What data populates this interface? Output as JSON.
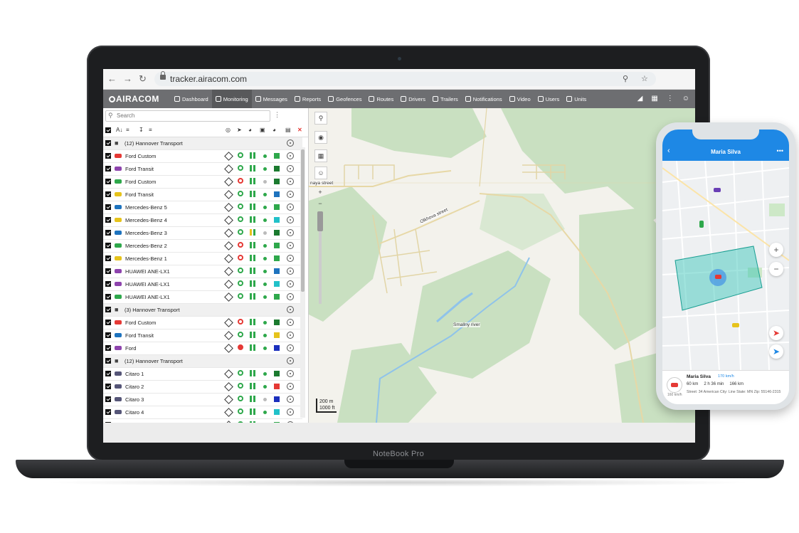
{
  "browser": {
    "url": "tracker.airacom.com",
    "back_icon": "arrow-left-icon",
    "forward_icon": "arrow-right-icon",
    "reload_icon": "reload-icon"
  },
  "app": {
    "brand": "AIRACOM",
    "nav": [
      {
        "label": "Dashboard",
        "icon": "chart-icon"
      },
      {
        "label": "Monitoring",
        "icon": "globe-icon"
      },
      {
        "label": "Messages",
        "icon": "document-icon"
      },
      {
        "label": "Reports",
        "icon": "report-icon"
      },
      {
        "label": "Geofences",
        "icon": "geofence-icon"
      },
      {
        "label": "Routes",
        "icon": "route-icon"
      },
      {
        "label": "Drivers",
        "icon": "steering-icon"
      },
      {
        "label": "Trailers",
        "icon": "trailer-icon"
      },
      {
        "label": "Notifications",
        "icon": "clock-icon"
      },
      {
        "label": "Video",
        "icon": "video-icon"
      },
      {
        "label": "Users",
        "icon": "user-icon"
      },
      {
        "label": "Units",
        "icon": "bus-icon"
      }
    ],
    "active_nav": "Monitoring"
  },
  "sidebar": {
    "search_placeholder": "Search",
    "rows": [
      {
        "type": "group",
        "label": "(12) Hannover Transport"
      },
      {
        "type": "unit",
        "label": "Ford Custom",
        "car": "#e53935",
        "ign": "green",
        "pause": "green",
        "dot": "green",
        "color": "#2ea84b"
      },
      {
        "type": "unit",
        "label": "Ford Transit",
        "car": "#8e44ad",
        "ign": "green",
        "pause": "green",
        "dot": "green",
        "color": "#1b7a2f"
      },
      {
        "type": "unit",
        "label": "Ford Custom",
        "car": "#2ea84b",
        "ign": "red",
        "pause": "green",
        "dot": "grey",
        "color": "#1b7a2f"
      },
      {
        "type": "unit",
        "label": "Ford Transit",
        "car": "#e6c31c",
        "ign": "green",
        "pause": "green",
        "dot": "green",
        "color": "#1e73be"
      },
      {
        "type": "unit",
        "label": "Mercedes-Benz 5",
        "car": "#1e73be",
        "ign": "green",
        "pause": "green",
        "dot": "green",
        "color": "#2ea84b"
      },
      {
        "type": "unit",
        "label": "Mercedes-Benz 4",
        "car": "#e6c31c",
        "ign": "green",
        "pause": "green",
        "dot": "green",
        "color": "#21c1c9"
      },
      {
        "type": "unit",
        "label": "Mercedes-Benz 3",
        "car": "#1e73be",
        "ign": "green",
        "pause": "yellow",
        "dot": "grey",
        "color": "#1b7a2f"
      },
      {
        "type": "unit",
        "label": "Mercedes-Benz 2",
        "car": "#2ea84b",
        "ign": "red",
        "pause": "green",
        "dot": "green",
        "color": "#2ea84b"
      },
      {
        "type": "unit",
        "label": "Mercedes-Benz 1",
        "car": "#e6c31c",
        "ign": "red",
        "pause": "green",
        "dot": "green",
        "color": "#2ea84b"
      },
      {
        "type": "unit",
        "label": "HUAWEI ANE-LX1",
        "car": "#8e44ad",
        "ign": "green",
        "pause": "green",
        "dot": "green",
        "color": "#1e73be"
      },
      {
        "type": "unit",
        "label": "HUAWEI ANE-LX1",
        "car": "#8e44ad",
        "ign": "green",
        "pause": "green",
        "dot": "green",
        "color": "#21c1c9"
      },
      {
        "type": "unit",
        "label": "HUAWEI ANE-LX1",
        "car": "#2ea84b",
        "ign": "green",
        "pause": "green",
        "dot": "green",
        "color": "#2ea84b"
      },
      {
        "type": "group",
        "label": "(3) Hannover Transport"
      },
      {
        "type": "unit",
        "label": "Ford Custom",
        "car": "#e53935",
        "ign": "red",
        "pause": "green",
        "dot": "green",
        "color": "#1b7a2f"
      },
      {
        "type": "unit",
        "label": "Ford Transit",
        "car": "#1e73be",
        "ign": "green",
        "pause": "green",
        "dot": "green",
        "color": "#e6c31c"
      },
      {
        "type": "unit",
        "label": "Ford",
        "car": "#8e44ad",
        "ign": "redfill",
        "pause": "green",
        "dot": "green",
        "color": "#1b2fbd"
      },
      {
        "type": "group",
        "label": "(12) Hannover Transport"
      },
      {
        "type": "unit",
        "label": "Citaro 1",
        "car": "#555577",
        "ign": "green",
        "pause": "green",
        "dot": "green",
        "color": "#1b7a2f"
      },
      {
        "type": "unit",
        "label": "Citaro 2",
        "car": "#555577",
        "ign": "green",
        "pause": "green",
        "dot": "green",
        "color": "#e53935"
      },
      {
        "type": "unit",
        "label": "Citaro 3",
        "car": "#555577",
        "ign": "green",
        "pause": "green",
        "dot": "grey",
        "color": "#1b2fbd"
      },
      {
        "type": "unit",
        "label": "Citaro 4",
        "car": "#555577",
        "ign": "green",
        "pause": "green",
        "dot": "green",
        "color": "#21c1c9"
      },
      {
        "type": "unit",
        "label": "Citaro 5",
        "car": "#555577",
        "ign": "green",
        "pause": "green",
        "dot": "green",
        "color": "#2ea84b"
      }
    ]
  },
  "map": {
    "street_1": "naya street",
    "street_2": "Olkhova street",
    "river": "Smallny river",
    "scale_m": "200 m",
    "scale_ft": "1000 ft"
  },
  "laptop": {
    "label": "NoteBook Pro"
  },
  "phone": {
    "title": "Maria Silva",
    "more": "•••",
    "name": "Maria Silva",
    "speed": "170 km/h",
    "stat_1": "60 km",
    "stat_2": "2 h 36 min",
    "stat_3": "166 km",
    "address": "Street: 34 American City: Line State: MN Zip: 55146-2315",
    "avatar_speed": "160 km/h"
  }
}
